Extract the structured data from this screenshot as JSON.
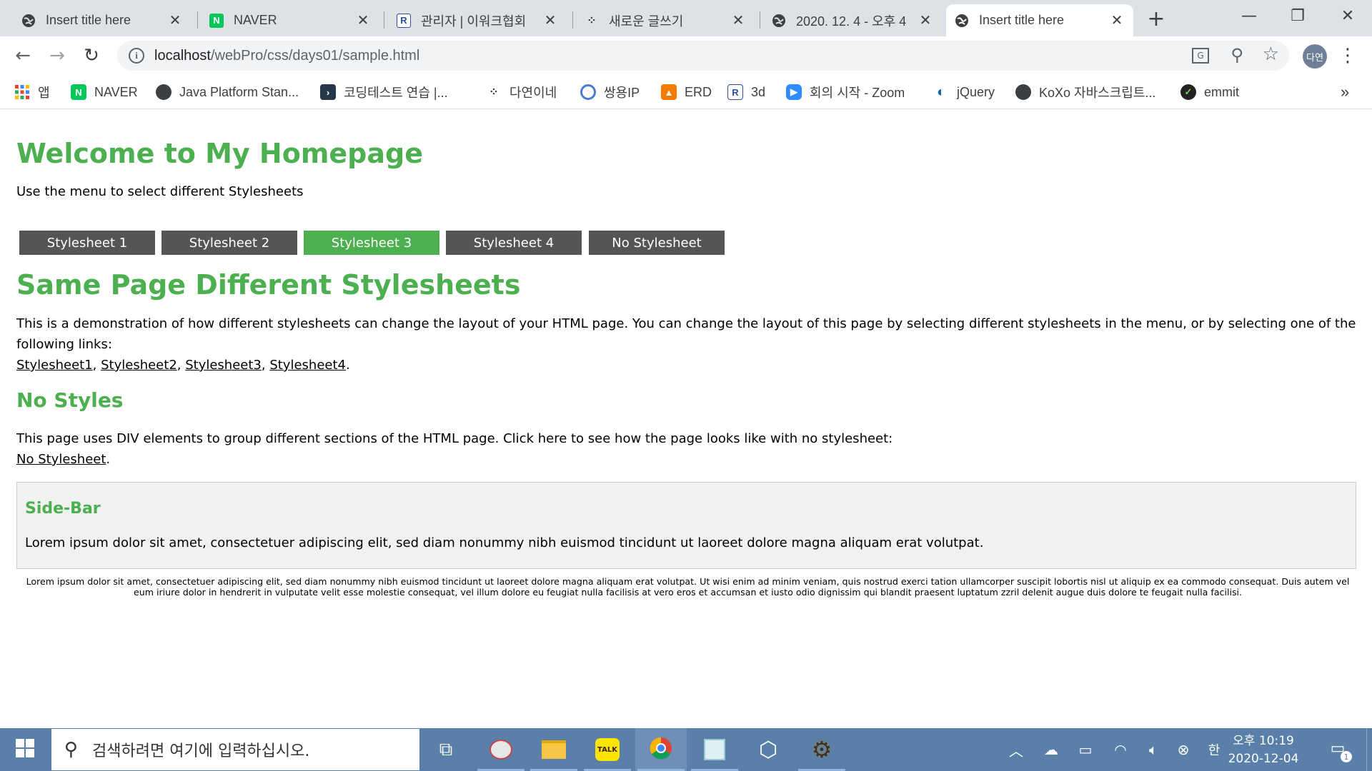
{
  "browser": {
    "tabs": [
      {
        "title": "Insert title here",
        "icon": "globe-icon"
      },
      {
        "title": "NAVER",
        "icon": "naver-icon"
      },
      {
        "title": "관리자 | 이워크협회",
        "icon": "r-logo-icon"
      },
      {
        "title": "새로운 글쓰기",
        "icon": "dots-icon"
      },
      {
        "title": "2020. 12. 4 - 오후 4",
        "icon": "globe-icon"
      },
      {
        "title": "Insert title here",
        "icon": "globe-icon",
        "active": true
      }
    ],
    "url_host": "localhost",
    "url_path": "/webPro/css/days01/sample.html",
    "profile_label": "다연",
    "bookmarks": [
      {
        "label": "앱",
        "icon": "apps-grid-icon"
      },
      {
        "label": "NAVER",
        "icon": "naver-icon"
      },
      {
        "label": "Java Platform Stan...",
        "icon": "globe-icon"
      },
      {
        "label": "코딩테스트 연습 |...",
        "icon": "programmers-icon"
      },
      {
        "label": "다연이네",
        "icon": "dots-icon"
      },
      {
        "label": "쌍용IP",
        "icon": "ssangyong-icon"
      },
      {
        "label": "ERD",
        "icon": "erd-icon"
      },
      {
        "label": "3d",
        "icon": "r-logo-icon"
      },
      {
        "label": "회의 시작 - Zoom",
        "icon": "zoom-icon"
      },
      {
        "label": "jQuery",
        "icon": "jquery-icon"
      },
      {
        "label": "KoXo 자바스크립트...",
        "icon": "globe-icon"
      },
      {
        "label": "emmit",
        "icon": "emmet-icon"
      }
    ],
    "more_label": "»"
  },
  "page": {
    "title": "Welcome to My Homepage",
    "intro": "Use the menu to select different Stylesheets",
    "menu": [
      {
        "label": "Stylesheet 1",
        "active": false
      },
      {
        "label": "Stylesheet 2",
        "active": false
      },
      {
        "label": "Stylesheet 3",
        "active": true
      },
      {
        "label": "Stylesheet 4",
        "active": false
      },
      {
        "label": "No Stylesheet",
        "active": false
      }
    ],
    "section1_title": "Same Page Different Stylesheets",
    "section1_text": "This is a demonstration of how different stylesheets can change the layout of your HTML page. You can change the layout of this page by selecting different stylesheets in the menu, or by selecting one of the following links:",
    "section1_links": [
      "Stylesheet1",
      "Stylesheet2",
      "Stylesheet3",
      "Stylesheet4"
    ],
    "section2_title": "No Styles",
    "section2_text": "This page uses DIV elements to group different sections of the HTML page. Click here to see how the page looks like with no stylesheet:",
    "section2_link": "No Stylesheet",
    "sidebar_title": "Side-Bar",
    "sidebar_text": "Lorem ipsum dolor sit amet, consectetuer adipiscing elit, sed diam nonummy nibh euismod tincidunt ut laoreet dolore magna aliquam erat volutpat.",
    "footer_text": "Lorem ipsum dolor sit amet, consectetuer adipiscing elit, sed diam nonummy nibh euismod tincidunt ut laoreet dolore magna aliquam erat volutpat. Ut wisi enim ad minim veniam, quis nostrud exerci tation ullamcorper suscipit lobortis nisl ut aliquip ex ea commodo consequat. Duis autem vel eum iriure dolor in hendrerit in vulputate velit esse molestie consequat, vel illum dolore eu feugiat nulla facilisis at vero eros et accumsan et iusto odio dignissim qui blandit praesent luptatum zzril delenit augue duis dolore te feugait nulla facilisi."
  },
  "taskbar": {
    "search_placeholder": "검색하려면 여기에 입력하십시오.",
    "ime_label": "한",
    "clock_time": "오후 10:19",
    "clock_date": "2020-12-04",
    "notification_count": "1"
  },
  "colors": {
    "heading_green": "#4caf50",
    "menu_gray": "#555555",
    "tabstrip": "#dee1e6",
    "taskbar": "#5a7fa8"
  }
}
